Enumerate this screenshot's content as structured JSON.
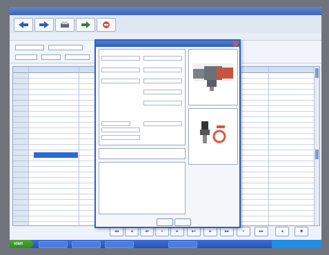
{
  "window": {
    "title": ""
  },
  "toolbar": {
    "buttons": [
      "back",
      "forward",
      "print",
      "export",
      "delete"
    ]
  },
  "menu": {
    "items": [
      "",
      ""
    ]
  },
  "dialog": {
    "title": "",
    "sections": [
      "",
      "",
      "",
      "",
      ""
    ],
    "ok_label": "",
    "cancel_label": ""
  },
  "navbar": {
    "buttons": [
      "◂◂",
      "◂",
      "◂▪",
      "▪",
      "▸",
      "▸▪",
      "▸",
      "▸▸",
      "▪",
      "▸▸",
      "◂",
      "■"
    ]
  },
  "taskbar": {
    "start_label": "start",
    "clock": ""
  },
  "colors": {
    "titlebar": "#3f66b5",
    "selection": "#2d68d8",
    "dialog_border": "#2f5fc0",
    "part_red": "#c8553b",
    "part_gray": "#6c7077"
  }
}
